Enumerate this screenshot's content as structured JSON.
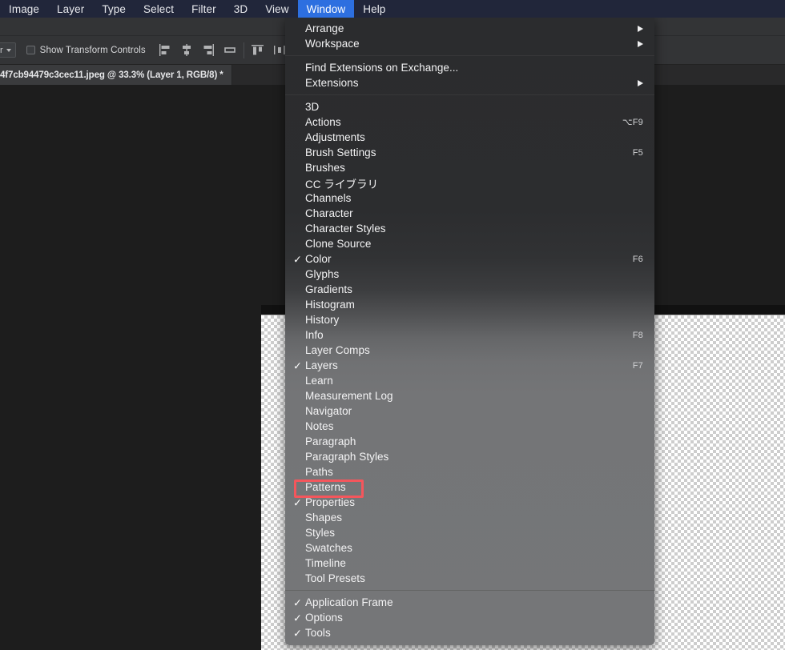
{
  "app": {
    "name": "Adobe Photoshop",
    "accent_blue": "#2d6fe0",
    "menubar_bg": "#21263a",
    "annotation_color": "#f4565c"
  },
  "menubar": {
    "items": [
      {
        "label": "Image",
        "active": false
      },
      {
        "label": "Layer",
        "active": false
      },
      {
        "label": "Type",
        "active": false
      },
      {
        "label": "Select",
        "active": false
      },
      {
        "label": "Filter",
        "active": false
      },
      {
        "label": "3D",
        "active": false
      },
      {
        "label": "View",
        "active": false
      },
      {
        "label": "Window",
        "active": true
      },
      {
        "label": "Help",
        "active": false
      }
    ]
  },
  "options_bar": {
    "tool_preset_value": "r",
    "show_transform_controls_label": "Show Transform Controls",
    "show_transform_controls_checked": false,
    "align_icons": [
      "align-left-edges-icon",
      "align-horizontal-centers-icon",
      "align-right-edges-icon",
      "align-vertical-centers-icon",
      "align-top-edges-icon",
      "distribute-horizontal-icon",
      "distribute-edges-icon"
    ]
  },
  "document_tab": {
    "title": "4f7cb94479c3cec11.jpeg @ 33.3% (Layer 1, RGB/8) *",
    "filename": "4f7cb94479c3cec11.jpeg",
    "zoom": "33.3%",
    "layer": "Layer 1",
    "color_mode": "RGB/8",
    "unsaved_marker": "*"
  },
  "window_menu": {
    "title": "Window",
    "groups": [
      {
        "items": [
          {
            "label": "Arrange",
            "checked": false,
            "shortcut": "",
            "submenu": true
          },
          {
            "label": "Workspace",
            "checked": false,
            "shortcut": "",
            "submenu": true
          }
        ]
      },
      {
        "items": [
          {
            "label": "Find Extensions on Exchange...",
            "checked": false,
            "shortcut": "",
            "submenu": false
          },
          {
            "label": "Extensions",
            "checked": false,
            "shortcut": "",
            "submenu": true
          }
        ]
      },
      {
        "items": [
          {
            "label": "3D",
            "checked": false,
            "shortcut": "",
            "submenu": false
          },
          {
            "label": "Actions",
            "checked": false,
            "shortcut": "⌥F9",
            "submenu": false
          },
          {
            "label": "Adjustments",
            "checked": false,
            "shortcut": "",
            "submenu": false
          },
          {
            "label": "Brush Settings",
            "checked": false,
            "shortcut": "F5",
            "submenu": false
          },
          {
            "label": "Brushes",
            "checked": false,
            "shortcut": "",
            "submenu": false
          },
          {
            "label": "CC ライブラリ",
            "checked": false,
            "shortcut": "",
            "submenu": false
          },
          {
            "label": "Channels",
            "checked": false,
            "shortcut": "",
            "submenu": false
          },
          {
            "label": "Character",
            "checked": false,
            "shortcut": "",
            "submenu": false
          },
          {
            "label": "Character Styles",
            "checked": false,
            "shortcut": "",
            "submenu": false
          },
          {
            "label": "Clone Source",
            "checked": false,
            "shortcut": "",
            "submenu": false
          },
          {
            "label": "Color",
            "checked": true,
            "shortcut": "F6",
            "submenu": false
          },
          {
            "label": "Glyphs",
            "checked": false,
            "shortcut": "",
            "submenu": false
          },
          {
            "label": "Gradients",
            "checked": false,
            "shortcut": "",
            "submenu": false
          },
          {
            "label": "Histogram",
            "checked": false,
            "shortcut": "",
            "submenu": false
          },
          {
            "label": "History",
            "checked": false,
            "shortcut": "",
            "submenu": false
          },
          {
            "label": "Info",
            "checked": false,
            "shortcut": "F8",
            "submenu": false
          },
          {
            "label": "Layer Comps",
            "checked": false,
            "shortcut": "",
            "submenu": false
          },
          {
            "label": "Layers",
            "checked": true,
            "shortcut": "F7",
            "submenu": false
          },
          {
            "label": "Learn",
            "checked": false,
            "shortcut": "",
            "submenu": false
          },
          {
            "label": "Measurement Log",
            "checked": false,
            "shortcut": "",
            "submenu": false
          },
          {
            "label": "Navigator",
            "checked": false,
            "shortcut": "",
            "submenu": false
          },
          {
            "label": "Notes",
            "checked": false,
            "shortcut": "",
            "submenu": false
          },
          {
            "label": "Paragraph",
            "checked": false,
            "shortcut": "",
            "submenu": false
          },
          {
            "label": "Paragraph Styles",
            "checked": false,
            "shortcut": "",
            "submenu": false
          },
          {
            "label": "Paths",
            "checked": false,
            "shortcut": "",
            "submenu": false
          },
          {
            "label": "Patterns",
            "checked": false,
            "shortcut": "",
            "submenu": false,
            "highlighted": true
          },
          {
            "label": "Properties",
            "checked": true,
            "shortcut": "",
            "submenu": false
          },
          {
            "label": "Shapes",
            "checked": false,
            "shortcut": "",
            "submenu": false
          },
          {
            "label": "Styles",
            "checked": false,
            "shortcut": "",
            "submenu": false
          },
          {
            "label": "Swatches",
            "checked": false,
            "shortcut": "",
            "submenu": false
          },
          {
            "label": "Timeline",
            "checked": false,
            "shortcut": "",
            "submenu": false
          },
          {
            "label": "Tool Presets",
            "checked": false,
            "shortcut": "",
            "submenu": false
          }
        ]
      },
      {
        "items": [
          {
            "label": "Application Frame",
            "checked": true,
            "shortcut": "",
            "submenu": false
          },
          {
            "label": "Options",
            "checked": true,
            "shortcut": "",
            "submenu": false
          },
          {
            "label": "Tools",
            "checked": true,
            "shortcut": "",
            "submenu": false
          }
        ]
      }
    ]
  },
  "annotation": {
    "target": "Patterns",
    "shape": "rectangle",
    "color": "#f4565c"
  }
}
